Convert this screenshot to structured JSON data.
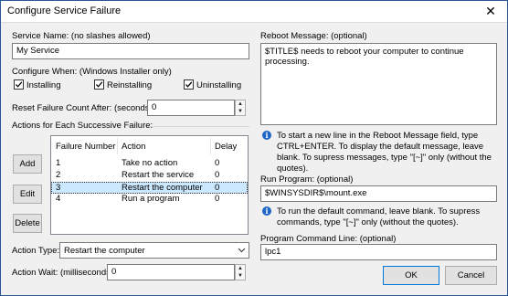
{
  "window": {
    "title": "Configure Service Failure",
    "close_glyph": "✕"
  },
  "service_name": {
    "label": "Service Name: (no slashes allowed)",
    "value": "My Service"
  },
  "configure_when": {
    "label": "Configure When: (Windows Installer only)",
    "installing": {
      "label": "Installing",
      "checked": true
    },
    "reinstalling": {
      "label": "Reinstalling",
      "checked": true
    },
    "uninstalling": {
      "label": "Uninstalling",
      "checked": true
    }
  },
  "reset_failure": {
    "label": "Reset Failure Count After: (seconds)",
    "value": "0"
  },
  "actions": {
    "label": "Actions for Each Successive Failure:",
    "columns": [
      "Failure Number",
      "Action",
      "Delay"
    ],
    "rows": [
      {
        "num": "1",
        "action": "Take no action",
        "delay": "0",
        "selected": false
      },
      {
        "num": "2",
        "action": "Restart the service",
        "delay": "0",
        "selected": false
      },
      {
        "num": "3",
        "action": "Restart the computer",
        "delay": "0",
        "selected": true
      },
      {
        "num": "4",
        "action": "Run a program",
        "delay": "0",
        "selected": false
      }
    ],
    "add_label": "Add",
    "edit_label": "Edit",
    "delete_label": "Delete"
  },
  "action_type": {
    "label": "Action Type:",
    "value": "Restart the computer"
  },
  "action_wait": {
    "label": "Action Wait: (milliseconds)",
    "value": "0"
  },
  "reboot_message": {
    "label": "Reboot Message: (optional)",
    "value": "$TITLE$ needs to reboot your computer to continue processing.",
    "note": "To start a new line in the Reboot Message field, type CTRL+ENTER. To display the default message, leave blank. To supress messages, type \"[~]\" only (without the quotes)."
  },
  "run_program": {
    "label": "Run Program: (optional)",
    "value": "$WINSYSDIR$\\mount.exe",
    "note": "To run the default command, leave blank. To supress commands, type \"[~]\" only (without the quotes)."
  },
  "program_command_line": {
    "label": "Program Command Line: (optional)",
    "value": "lpc1"
  },
  "buttons": {
    "ok": "OK",
    "cancel": "Cancel"
  },
  "colors": {
    "accent": "#0078d7",
    "selection": "#cce8ff",
    "info": "#1e63c6"
  }
}
